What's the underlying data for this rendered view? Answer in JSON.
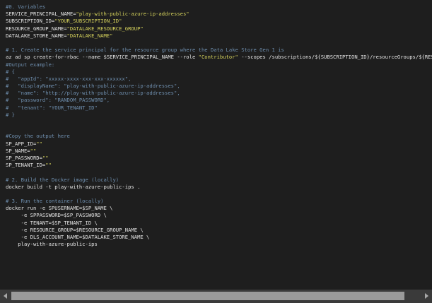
{
  "code": {
    "lines": [
      [
        {
          "t": "comment",
          "s": "#0. Variables"
        }
      ],
      [
        {
          "t": "plain",
          "s": "SERVICE_PRINCIPAL_NAME="
        },
        {
          "t": "string",
          "s": "\"play-with-public-azure-ip-addresses\""
        }
      ],
      [
        {
          "t": "plain",
          "s": "SUBSCRIPTION_ID="
        },
        {
          "t": "string",
          "s": "\"YOUR_SUBSCRIPTION_ID\""
        }
      ],
      [
        {
          "t": "plain",
          "s": "RESOURCE_GROUP_NAME="
        },
        {
          "t": "string",
          "s": "\"DATALAKE_RESOURCE_GROUP\""
        }
      ],
      [
        {
          "t": "plain",
          "s": "DATALAKE_STORE_NAME="
        },
        {
          "t": "string",
          "s": "\"DATALAKE_NAME\""
        }
      ],
      [],
      [
        {
          "t": "comment",
          "s": "# 1. Create the service principal for the resource group where the Data Lake Store Gen 1 is"
        }
      ],
      [
        {
          "t": "plain",
          "s": "az ad sp create-for-rbac --name $SERVICE_PRINCIPAL_NAME --role "
        },
        {
          "t": "string",
          "s": "\"Contributor\""
        },
        {
          "t": "plain",
          "s": " --scopes /subscriptions/${SUBSCRIPTION_ID}/resourceGroups/${RESOURCE_GROUP_NAME}"
        }
      ],
      [
        {
          "t": "comment",
          "s": "#Output example:"
        }
      ],
      [
        {
          "t": "comment",
          "s": "# {"
        }
      ],
      [
        {
          "t": "comment",
          "s": "#   \"appId\": \"xxxxx-xxxx-xxx-xxx-xxxxxx\","
        }
      ],
      [
        {
          "t": "comment",
          "s": "#   \"displayName\": \"play-with-public-azure-ip-addresses\","
        }
      ],
      [
        {
          "t": "comment",
          "s": "#   \"name\": \"http://play-with-public-azure-ip-addresses\","
        }
      ],
      [
        {
          "t": "comment",
          "s": "#   \"password\": \"RANDOM_PASSWORD\","
        }
      ],
      [
        {
          "t": "comment",
          "s": "#   \"tenant\": \"YOUR_TENANT_ID\""
        }
      ],
      [
        {
          "t": "comment",
          "s": "# }"
        }
      ],
      [],
      [],
      [
        {
          "t": "comment",
          "s": "#Copy the output here"
        }
      ],
      [
        {
          "t": "plain",
          "s": "SP_APP_ID="
        },
        {
          "t": "string",
          "s": "\"\""
        }
      ],
      [
        {
          "t": "plain",
          "s": "SP_NAME="
        },
        {
          "t": "string",
          "s": "\"\""
        }
      ],
      [
        {
          "t": "plain",
          "s": "SP_PASSWORD="
        },
        {
          "t": "string",
          "s": "\"\""
        }
      ],
      [
        {
          "t": "plain",
          "s": "SP_TENANT_ID="
        },
        {
          "t": "string",
          "s": "\"\""
        }
      ],
      [],
      [
        {
          "t": "comment",
          "s": "# 2. Build the Docker image (locally)"
        }
      ],
      [
        {
          "t": "plain",
          "s": "docker build -t play-with-azure-public-ips ."
        }
      ],
      [],
      [
        {
          "t": "comment",
          "s": "# 3. Run the container (locally)"
        }
      ],
      [
        {
          "t": "plain",
          "s": "docker run -e SPUSERNAME=$SP_NAME \\"
        }
      ],
      [
        {
          "t": "plain",
          "s": "     -e SPPASSWORD=$SP_PASSWORD \\"
        }
      ],
      [
        {
          "t": "plain",
          "s": "     -e TENANT=$SP_TENANT_ID \\"
        }
      ],
      [
        {
          "t": "plain",
          "s": "     -e RESOURCE_GROUP=$RESOURCE_GROUP_NAME \\"
        }
      ],
      [
        {
          "t": "plain",
          "s": "     -e DLS_ACCOUNT_NAME=$DATALAKE_STORE_NAME \\"
        }
      ],
      [
        {
          "t": "plain",
          "s": "    play-with-azure-public-ips"
        }
      ]
    ]
  },
  "scrollbar": {
    "left_arrow_icon": "triangle-left-icon",
    "right_arrow_icon": "triangle-right-icon",
    "thumb_fraction": 0.96,
    "thumb_offset": 0.0
  },
  "colors": {
    "background": "#1e1e1e",
    "comment": "#6f8faf",
    "string": "#d6d35c",
    "plain": "#e4e4e4",
    "scrollbar_track": "#3a3a3a",
    "scrollbar_thumb": "#9a9a9a"
  }
}
